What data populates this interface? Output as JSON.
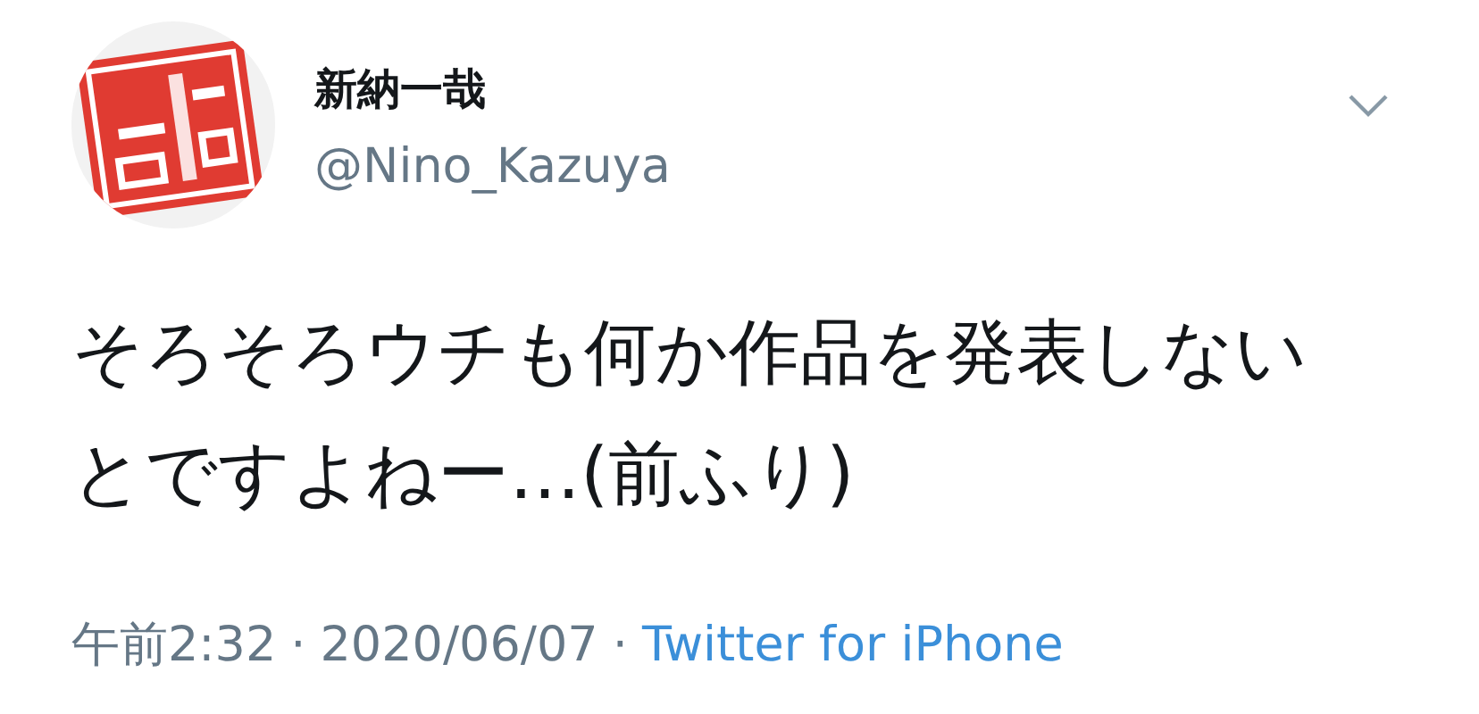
{
  "author": {
    "display_name": "新納一哉",
    "handle": "@Nino_Kazuya"
  },
  "tweet": {
    "text": "そろそろウチも何か作品を発表しないとですよねー…(前ふり)"
  },
  "meta": {
    "time": "午前2:32",
    "separator_1": "·",
    "date": "2020/06/07",
    "separator_2": "·",
    "source": "Twitter for iPhone"
  }
}
